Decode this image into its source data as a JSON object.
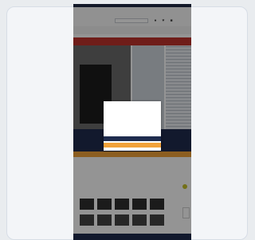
{
  "colors": {
    "header_navy": "#1f2c4e",
    "promo_red": "#c0322b",
    "accent_orange": "#f2a23a"
  },
  "icons": [
    "search-icon",
    "user-icon",
    "heart-icon",
    "cart-icon",
    "chat-icon",
    "trust-badge-icon"
  ]
}
